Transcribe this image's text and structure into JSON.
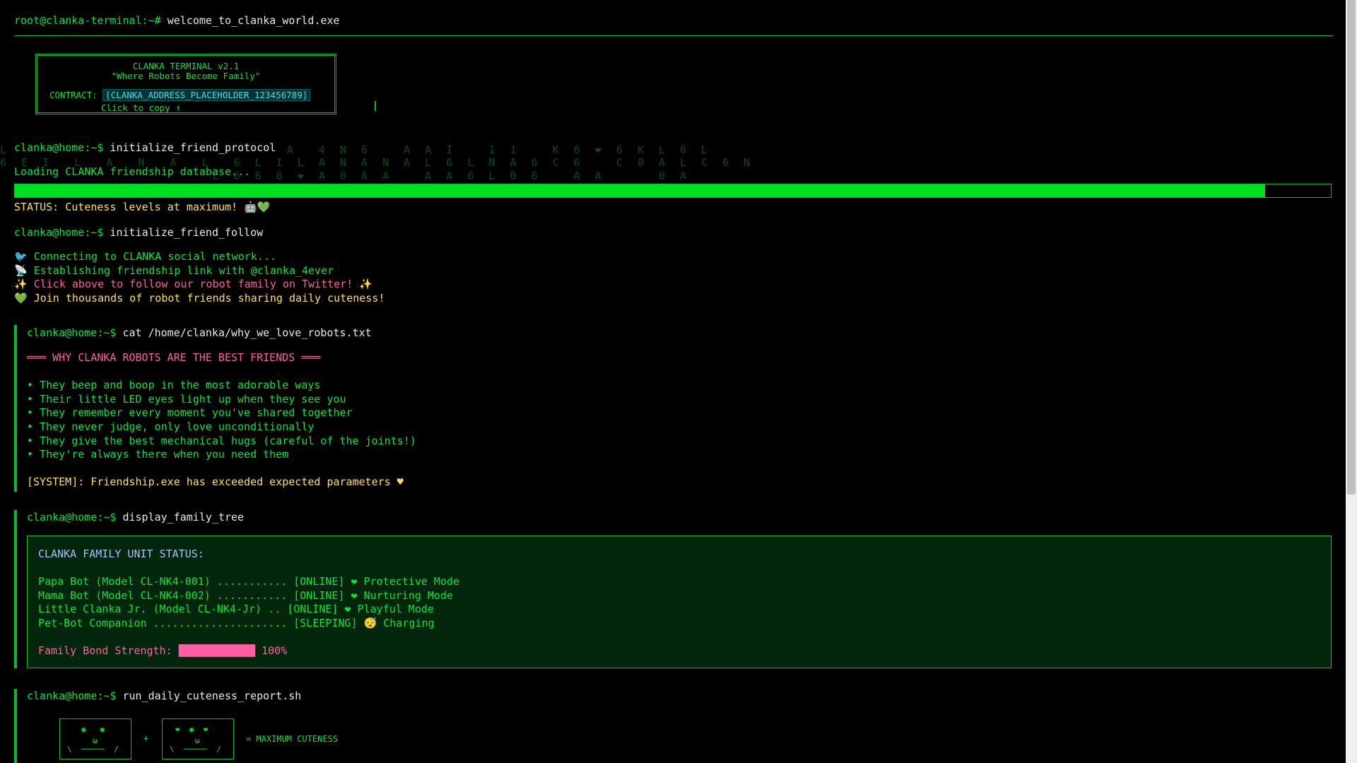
{
  "header": {
    "prompt": "root@clanka-terminal:~#",
    "command": "welcome_to_clanka_world.exe"
  },
  "banner": {
    "title": "CLANKA TERMINAL v2.1",
    "subtitle": "\"Where Robots Become Family\"",
    "contract_label": "CONTRACT:",
    "contract_value": "[CLANKA_ADDRESS_PLACEHOLDER_123456789]",
    "copy_hint": "Click to copy ↑"
  },
  "matrix_rain": {
    "line1": "L                          A  4 N 6   A A I   1 1   K 6 ❤ 6 K L 6 L",
    "line2": "6 E I  L  A  N  A  L  6 L I L A N A N A L 6 L N A 6 C 6   C 0 A L C 6 N",
    "line3": "                    L 6 6 6 ❤ A 0 A A   A A 6 L 0 6   A A     0 A"
  },
  "sections": {
    "friend_protocol": {
      "prompt": "clanka@home:~$",
      "command": "initialize_friend_protocol",
      "loading": "Loading CLANKA friendship database...",
      "progress": 0.95,
      "status": "STATUS: Cuteness levels at maximum! 🤖💚"
    },
    "friend_follow": {
      "prompt": "clanka@home:~$",
      "command": "initialize_friend_follow",
      "lines": [
        "🐦 Connecting to CLANKA social network...",
        "📡 Establishing friendship link with @clanka_4ever",
        "✨ Click above to follow our robot family on Twitter! ✨",
        "💚 Join thousands of robot friends sharing daily cuteness!"
      ]
    },
    "why_robots": {
      "prompt": "clanka@home:~$",
      "command": "cat /home/clanka/why_we_love_robots.txt",
      "heading": "═══ WHY CLANKA ROBOTS ARE THE BEST FRIENDS ═══",
      "items": [
        "• They beep and boop in the most adorable ways",
        "• Their little LED eyes light up when they see you",
        "• They remember every moment you've shared together",
        "• They never judge, only love unconditionally",
        "• They give the best mechanical hugs (careful of the joints!)",
        "• They're always there when you need them"
      ],
      "system": "[SYSTEM]: Friendship.exe has exceeded expected parameters ♥"
    },
    "family_tree": {
      "prompt": "clanka@home:~$",
      "command": "display_family_tree",
      "title": "CLANKA FAMILY UNIT STATUS:",
      "members": [
        "Papa Bot (Model CL-NK4-001) ........... [ONLINE] ❤ Protective Mode",
        "Mama Bot (Model CL-NK4-002) ........... [ONLINE] ❤ Nurturing Mode",
        "Little Clanka Jr. (Model CL-NK4-Jr) .. [ONLINE] ❤ Playful Mode",
        "Pet-Bot Companion ..................... [SLEEPING] 😴 Charging"
      ],
      "bond_label": "Family Bond Strength:",
      "bond_bar": "████████████",
      "bond_value": "100%"
    },
    "cuteness_report": {
      "prompt": "clanka@home:~$",
      "command": "run_daily_cuteness_report.sh",
      "robot1_eyes": "◉   ◉",
      "robot1_mouth": "ω",
      "robot1_bottom": "\\  ─────  /",
      "robot2_eyes": "❤  ◉  ❤",
      "robot2_mouth": "ω",
      "robot2_bottom": "\\  ─────  /",
      "plus": "+",
      "result": "= MAXIMUM CUTENESS"
    }
  },
  "colors": {
    "background": "#000000",
    "green": "#00e83a",
    "yellow": "#ffe14a",
    "pink": "#ff5fa2",
    "cyan": "#48e0e0"
  }
}
